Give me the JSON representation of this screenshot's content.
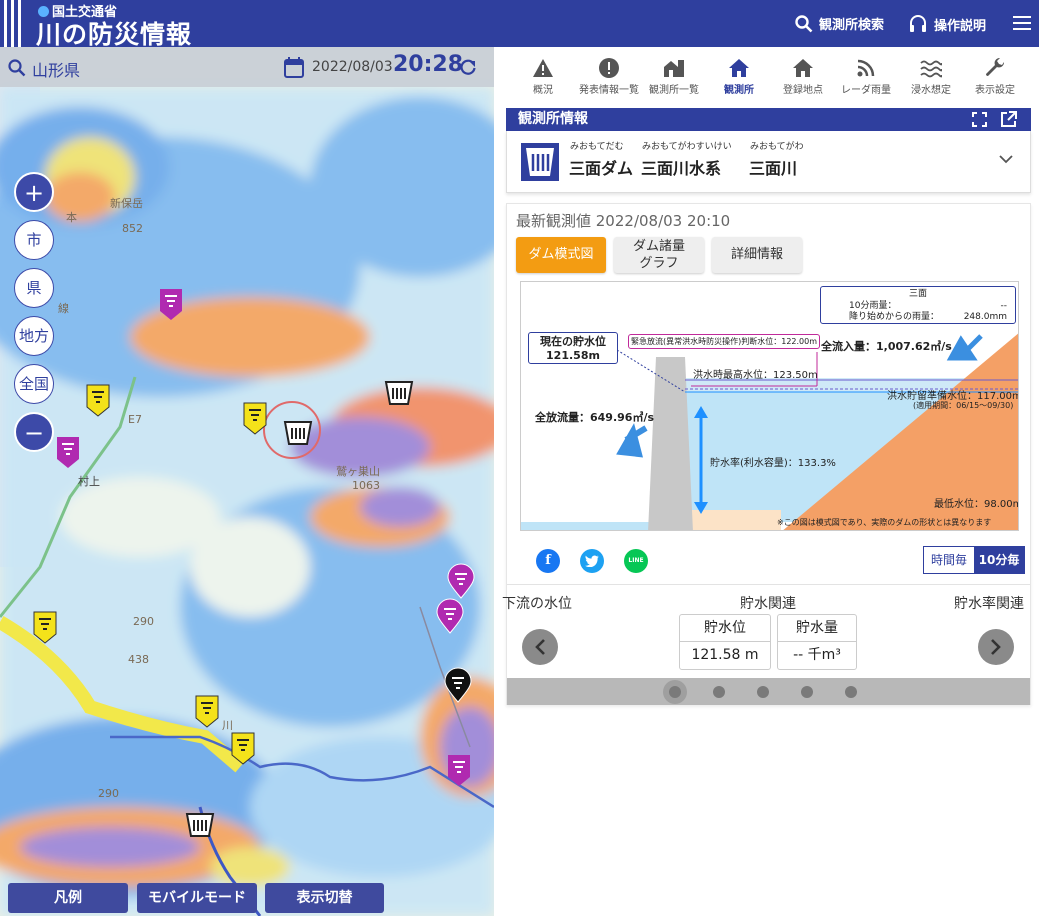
{
  "header": {
    "ministry": "国土交通省",
    "title": "川の防災情報",
    "search_label": "観測所検索",
    "help_label": "操作説明"
  },
  "map": {
    "area": "山形県",
    "date": "2022/08/03",
    "time": "20:28",
    "scope_buttons": [
      "市",
      "県",
      "地方",
      "全国"
    ],
    "place_labels": [
      "新保岳",
      "852",
      "1063",
      "438",
      "290",
      "290",
      "E7",
      "村上",
      "鷲ヶ巣山",
      "川",
      "本",
      "線"
    ],
    "bottom_buttons": [
      "凡例",
      "モバイルモード",
      "表示切替"
    ]
  },
  "nav": {
    "items": [
      "概況",
      "発表情報一覧",
      "観測所一覧",
      "観測所",
      "登録地点",
      "レーダ雨量",
      "浸水想定",
      "表示設定"
    ],
    "active": "観測所"
  },
  "station_card": {
    "title": "観測所情報",
    "dam_ruby": "みおもてだむ",
    "dam_name": "三面ダム",
    "system_ruby": "みおもてがわすいけい",
    "system_name": "三面川水系",
    "river_ruby": "みおもてがわ",
    "river_name": "三面川"
  },
  "observation": {
    "latest": "最新観測値 2022/08/03 20:10",
    "tabs": [
      "ダム模式図",
      "ダム諸量\nグラフ",
      "詳細情報"
    ],
    "active_tab": "ダム模式図"
  },
  "diagram": {
    "rain_station": "三面",
    "rain_10min_label": "10分雨量：",
    "rain_10min_value": "--",
    "rain_total_label": "降り始めからの雨量：",
    "rain_total_value": "248.0mm",
    "current_level_label": "現在の貯水位",
    "current_level_value": "121.58m",
    "emergency_level": "緊急放流(異常洪水時防災操作)判断水位：122.00m",
    "inflow": "全流入量：1,007.62㎥/s",
    "flood_max_level": "洪水時最高水位：123.50m",
    "flood_reserve_level": "洪水貯留準備水位：117.00m",
    "flood_reserve_period": "(適用期間：06/15〜09/30)",
    "outflow": "全放流量：649.96㎥/s",
    "storage_rate": "貯水率(利水容量)：133.3%",
    "min_level": "最低水位：98.00m",
    "note": "※この図は模式図であり、実際のダムの形状とは異なります"
  },
  "social": [
    "f",
    "t",
    "LINE"
  ],
  "interval_toggle": {
    "hourly": "時間毎",
    "ten_min": "10分毎",
    "active": "10分毎"
  },
  "related": {
    "left": "下流の水位",
    "center": "貯水関連",
    "right": "貯水率関連",
    "values": [
      {
        "label": "貯水位",
        "value": "121.58 m"
      },
      {
        "label": "貯水量",
        "value": "--  千m³"
      }
    ],
    "page_count": 5,
    "current_page": 1
  },
  "colors": {
    "brand": "#2f3f9e",
    "accent_orange": "#f39c12",
    "water": "#bfe4f7",
    "sediment": "#f4a066"
  }
}
